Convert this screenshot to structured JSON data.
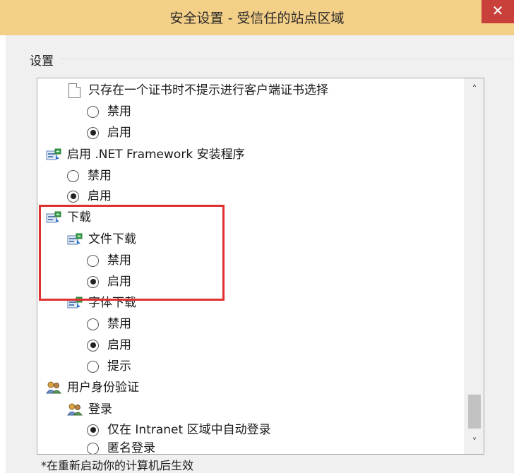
{
  "window": {
    "title": "安全设置 - 受信任的站点区域",
    "close_glyph": "✕"
  },
  "group_label": "设置",
  "tree": [
    {
      "type": "item",
      "icon": "document-icon",
      "label": "只存在一个证书时不提示进行客户端证书选择"
    },
    {
      "type": "radio",
      "label": "禁用",
      "checked": false
    },
    {
      "type": "radio",
      "label": "启用",
      "checked": true
    },
    {
      "type": "item",
      "icon": "settings-icon",
      "label": "启用 .NET Framework 安装程序"
    },
    {
      "type": "radio",
      "label": "禁用",
      "checked": false
    },
    {
      "type": "radio",
      "label": "启用",
      "checked": true
    },
    {
      "type": "item",
      "icon": "settings-icon",
      "label": "下载"
    },
    {
      "type": "item",
      "icon": "settings-icon",
      "label": "文件下载"
    },
    {
      "type": "radio",
      "label": "禁用",
      "checked": false
    },
    {
      "type": "radio",
      "label": "启用",
      "checked": true
    },
    {
      "type": "item",
      "icon": "settings-icon",
      "label": "字体下载"
    },
    {
      "type": "radio",
      "label": "禁用",
      "checked": false
    },
    {
      "type": "radio",
      "label": "启用",
      "checked": true
    },
    {
      "type": "radio",
      "label": "提示",
      "checked": false
    },
    {
      "type": "item",
      "icon": "users-icon",
      "label": "用户身份验证"
    },
    {
      "type": "item",
      "icon": "users-icon",
      "label": "登录"
    },
    {
      "type": "radio",
      "label": "仅在 Intranet 区域中自动登录",
      "checked": true
    },
    {
      "type": "radio",
      "label": "匿名登录",
      "checked": false
    }
  ],
  "scrollbar": {
    "up_glyph": "˄",
    "down_glyph": "˅"
  },
  "note": "*在重新启动你的计算机后生效",
  "colors": {
    "titlebar": "#f4cf87",
    "close": "#c9403a",
    "highlight": "#e03030"
  }
}
